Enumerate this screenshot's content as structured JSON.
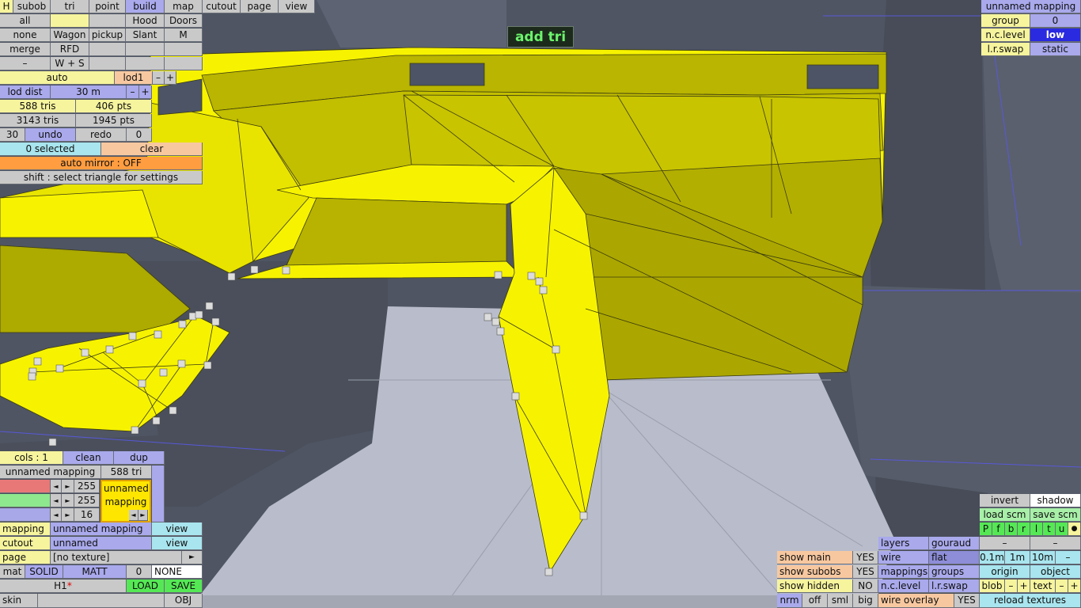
{
  "top_menu": [
    "H",
    "subob",
    "tri",
    "point",
    "build",
    "map",
    "cutout",
    "page",
    "view"
  ],
  "left_panel": {
    "row1": [
      "all",
      "",
      "Hood",
      "Doors"
    ],
    "row2": [
      "none",
      "Wagon",
      "pickup",
      "Slant",
      "M"
    ],
    "row3": [
      "merge",
      "RFD"
    ],
    "row4": [
      "–",
      "W + S"
    ],
    "lod": {
      "mode": "auto",
      "level": "lod1",
      "minus": "–",
      "plus": "+"
    },
    "lod_dist": {
      "label": "lod dist",
      "value": "30 m",
      "minus": "–",
      "plus": "+"
    },
    "tris_a": "588 tris",
    "pts_a": "406 pts",
    "tris_b": "3143 tris",
    "pts_b": "1945 pts",
    "undo_count": "30",
    "undo": "undo",
    "redo": "redo",
    "redo_count": "0",
    "selected": "0 selected",
    "clear": "clear",
    "auto_mirror": "auto mirror : OFF",
    "hint": "shift : select triangle for settings"
  },
  "tooltip": "add tri",
  "top_right": {
    "mapping_name": "unnamed mapping",
    "group_label": "group",
    "group_value": "0",
    "nc_label": "n.c.level",
    "nc_value": "low",
    "lr_label": "l.r.swap",
    "lr_value": "static"
  },
  "bottom_left": {
    "cols": "cols : 1",
    "clean": "clean",
    "dup": "dup",
    "mapping_name": "unnamed mapping",
    "tri_count": "588 tri",
    "color_values": [
      "255",
      "255",
      "16"
    ],
    "preview_text": "unnamed mapping",
    "arrow_left": "◄",
    "arrow_right": "►",
    "mapping_label": "mapping",
    "mapping_value": "unnamed mapping",
    "view1": "view",
    "cutout_label": "cutout",
    "cutout_value": "unnamed",
    "view2": "view",
    "page_label": "page",
    "page_value": "[no texture]",
    "page_arrow": "►",
    "mat": "mat",
    "solid": "SOLID",
    "matt": "MATT",
    "mat_num": "0",
    "none": "NONE",
    "file": "H1",
    "file_mark": "*",
    "load": "LOAD",
    "save": "SAVE",
    "skin": "skin",
    "obj": "OBJ"
  },
  "bottom_center": {
    "show_main": "show main",
    "show_main_v": "YES",
    "show_subobs": "show subobs",
    "show_subobs_v": "YES",
    "show_hidden": "show hidden",
    "show_hidden_v": "NO",
    "nrm": "nrm",
    "off": "off",
    "sml": "sml",
    "big": "big",
    "layers": "layers",
    "gouraud": "gouraud",
    "wire": "wire",
    "flat": "flat",
    "mappings": "mappings",
    "groups": "groups",
    "nc_level": "n.c.level",
    "lr_swap": "l.r.swap",
    "wire_overlay": "wire overlay",
    "wire_overlay_v": "YES"
  },
  "bottom_right": {
    "invert": "invert",
    "shadow": "shadow",
    "load_scm": "load scm",
    "save_scm": "save scm",
    "letters": [
      "P",
      "f",
      "b",
      "r",
      "l",
      "t",
      "u",
      "●"
    ],
    "dash1": "–",
    "dash2": "–",
    "s01": "0.1m",
    "s1": "1m",
    "s10": "10m",
    "s_dash": "–",
    "origin": "origin",
    "object": "object",
    "blob": "blob",
    "minus": "–",
    "plus": "+",
    "text": "text",
    "reload": "reload textures"
  },
  "colors": {
    "mesh": "#f7f300",
    "mesh_dark": "#b7b300",
    "floor": "#b9bdcb",
    "background": "#4f5563",
    "accent_blue": "#a9a9ec",
    "accent_yellow": "#f6f49d",
    "accent_green": "#55e855",
    "accent_orange": "#ff9d40"
  }
}
